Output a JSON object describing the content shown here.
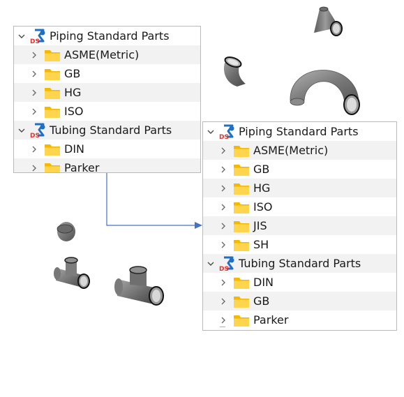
{
  "left_tree": {
    "items": [
      {
        "label": "Piping Standard Parts",
        "level": 0,
        "expanded": true,
        "icon": "ds-piping-library-icon"
      },
      {
        "label": "ASME(Metric)",
        "level": 1,
        "expanded": false,
        "icon": "folder-icon"
      },
      {
        "label": "GB",
        "level": 1,
        "expanded": false,
        "icon": "folder-icon"
      },
      {
        "label": "HG",
        "level": 1,
        "expanded": false,
        "icon": "folder-icon"
      },
      {
        "label": "ISO",
        "level": 1,
        "expanded": false,
        "icon": "folder-icon"
      },
      {
        "label": "Tubing Standard Parts",
        "level": 0,
        "expanded": true,
        "icon": "ds-tubing-library-icon"
      },
      {
        "label": "DIN",
        "level": 1,
        "expanded": false,
        "icon": "folder-icon"
      },
      {
        "label": "Parker",
        "level": 1,
        "expanded": false,
        "icon": "folder-icon"
      }
    ]
  },
  "right_tree": {
    "items": [
      {
        "label": "Piping Standard Parts",
        "level": 0,
        "expanded": true,
        "icon": "ds-piping-library-icon"
      },
      {
        "label": "ASME(Metric)",
        "level": 1,
        "expanded": false,
        "icon": "folder-icon"
      },
      {
        "label": "GB",
        "level": 1,
        "expanded": false,
        "icon": "folder-icon"
      },
      {
        "label": "HG",
        "level": 1,
        "expanded": false,
        "icon": "folder-icon"
      },
      {
        "label": "ISO",
        "level": 1,
        "expanded": false,
        "icon": "folder-icon"
      },
      {
        "label": "JIS",
        "level": 1,
        "expanded": false,
        "icon": "folder-icon"
      },
      {
        "label": "SH",
        "level": 1,
        "expanded": false,
        "icon": "folder-icon"
      },
      {
        "label": "Tubing Standard Parts",
        "level": 0,
        "expanded": true,
        "icon": "ds-tubing-library-icon"
      },
      {
        "label": "DIN",
        "level": 1,
        "expanded": false,
        "icon": "folder-icon"
      },
      {
        "label": "GB",
        "level": 1,
        "expanded": false,
        "icon": "folder-icon"
      },
      {
        "label": "Parker",
        "level": 1,
        "expanded": false,
        "icon": "folder-icon"
      }
    ]
  },
  "parts": [
    {
      "name": "reducer",
      "icon": "pipe-reducer-icon"
    },
    {
      "name": "elbow-45",
      "icon": "pipe-elbow-45-icon"
    },
    {
      "name": "return-bend",
      "icon": "pipe-return-bend-icon"
    },
    {
      "name": "cap",
      "icon": "pipe-cap-icon"
    },
    {
      "name": "tee",
      "icon": "pipe-tee-icon"
    },
    {
      "name": "tee-reducing",
      "icon": "pipe-tee-reducing-icon"
    }
  ],
  "colors": {
    "folder": "#f5b800",
    "folder_light": "#ffd54d",
    "ds_blue": "#1f6fc5",
    "ds_red": "#e8312f",
    "connector": "#4472c4",
    "part_gray": "#7a7a7a",
    "row_stripe": "#f2f2f2",
    "panel_border": "#b9b9b9"
  }
}
